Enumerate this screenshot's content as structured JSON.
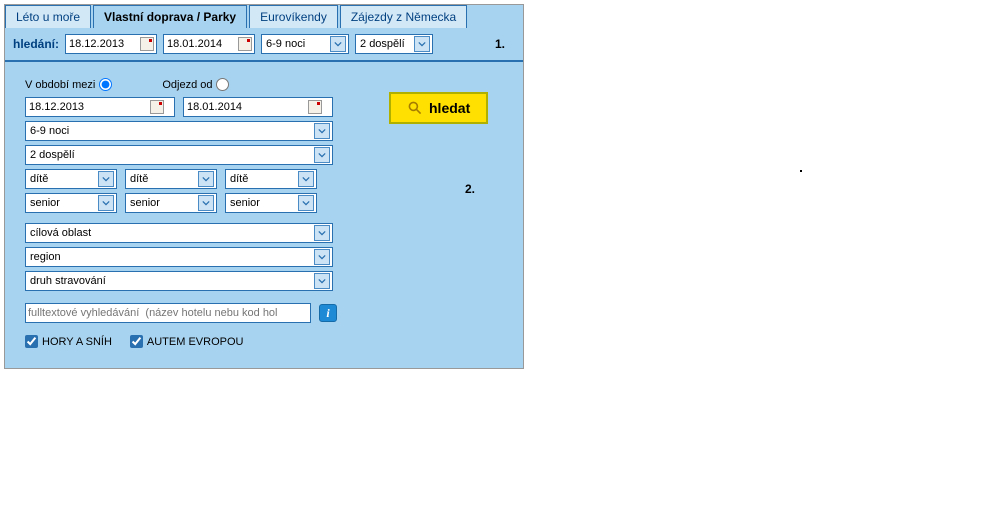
{
  "tabs": {
    "t0": "Léto u moře",
    "t1": "Vlastní doprava / Parky",
    "t2": "Eurovíkendy",
    "t3": "Zájezdy z Německa"
  },
  "searchbar": {
    "label": "hledání:",
    "date_from": "18.12.2013",
    "date_to": "18.01.2014",
    "nights": "6-9 noci",
    "adults": "2 dospělí",
    "marker": "1."
  },
  "form": {
    "period_label": "V období mezi",
    "depart_label": "Odjezd od",
    "date_from": "18.12.2013",
    "date_to": "18.01.2014",
    "nights": "6-9 noci",
    "adults": "2 dospělí",
    "child": "dítě",
    "senior": "senior",
    "dest": "cílová oblast",
    "region": "region",
    "meal": "druh stravování",
    "fulltext_placeholder": "fulltextové vyhledávání  (název hotelu nebu kod hol",
    "search_btn": "hledat",
    "marker": "2.",
    "chk1": "HORY A SNÍH",
    "chk2": "AUTEM EVROPOU"
  }
}
